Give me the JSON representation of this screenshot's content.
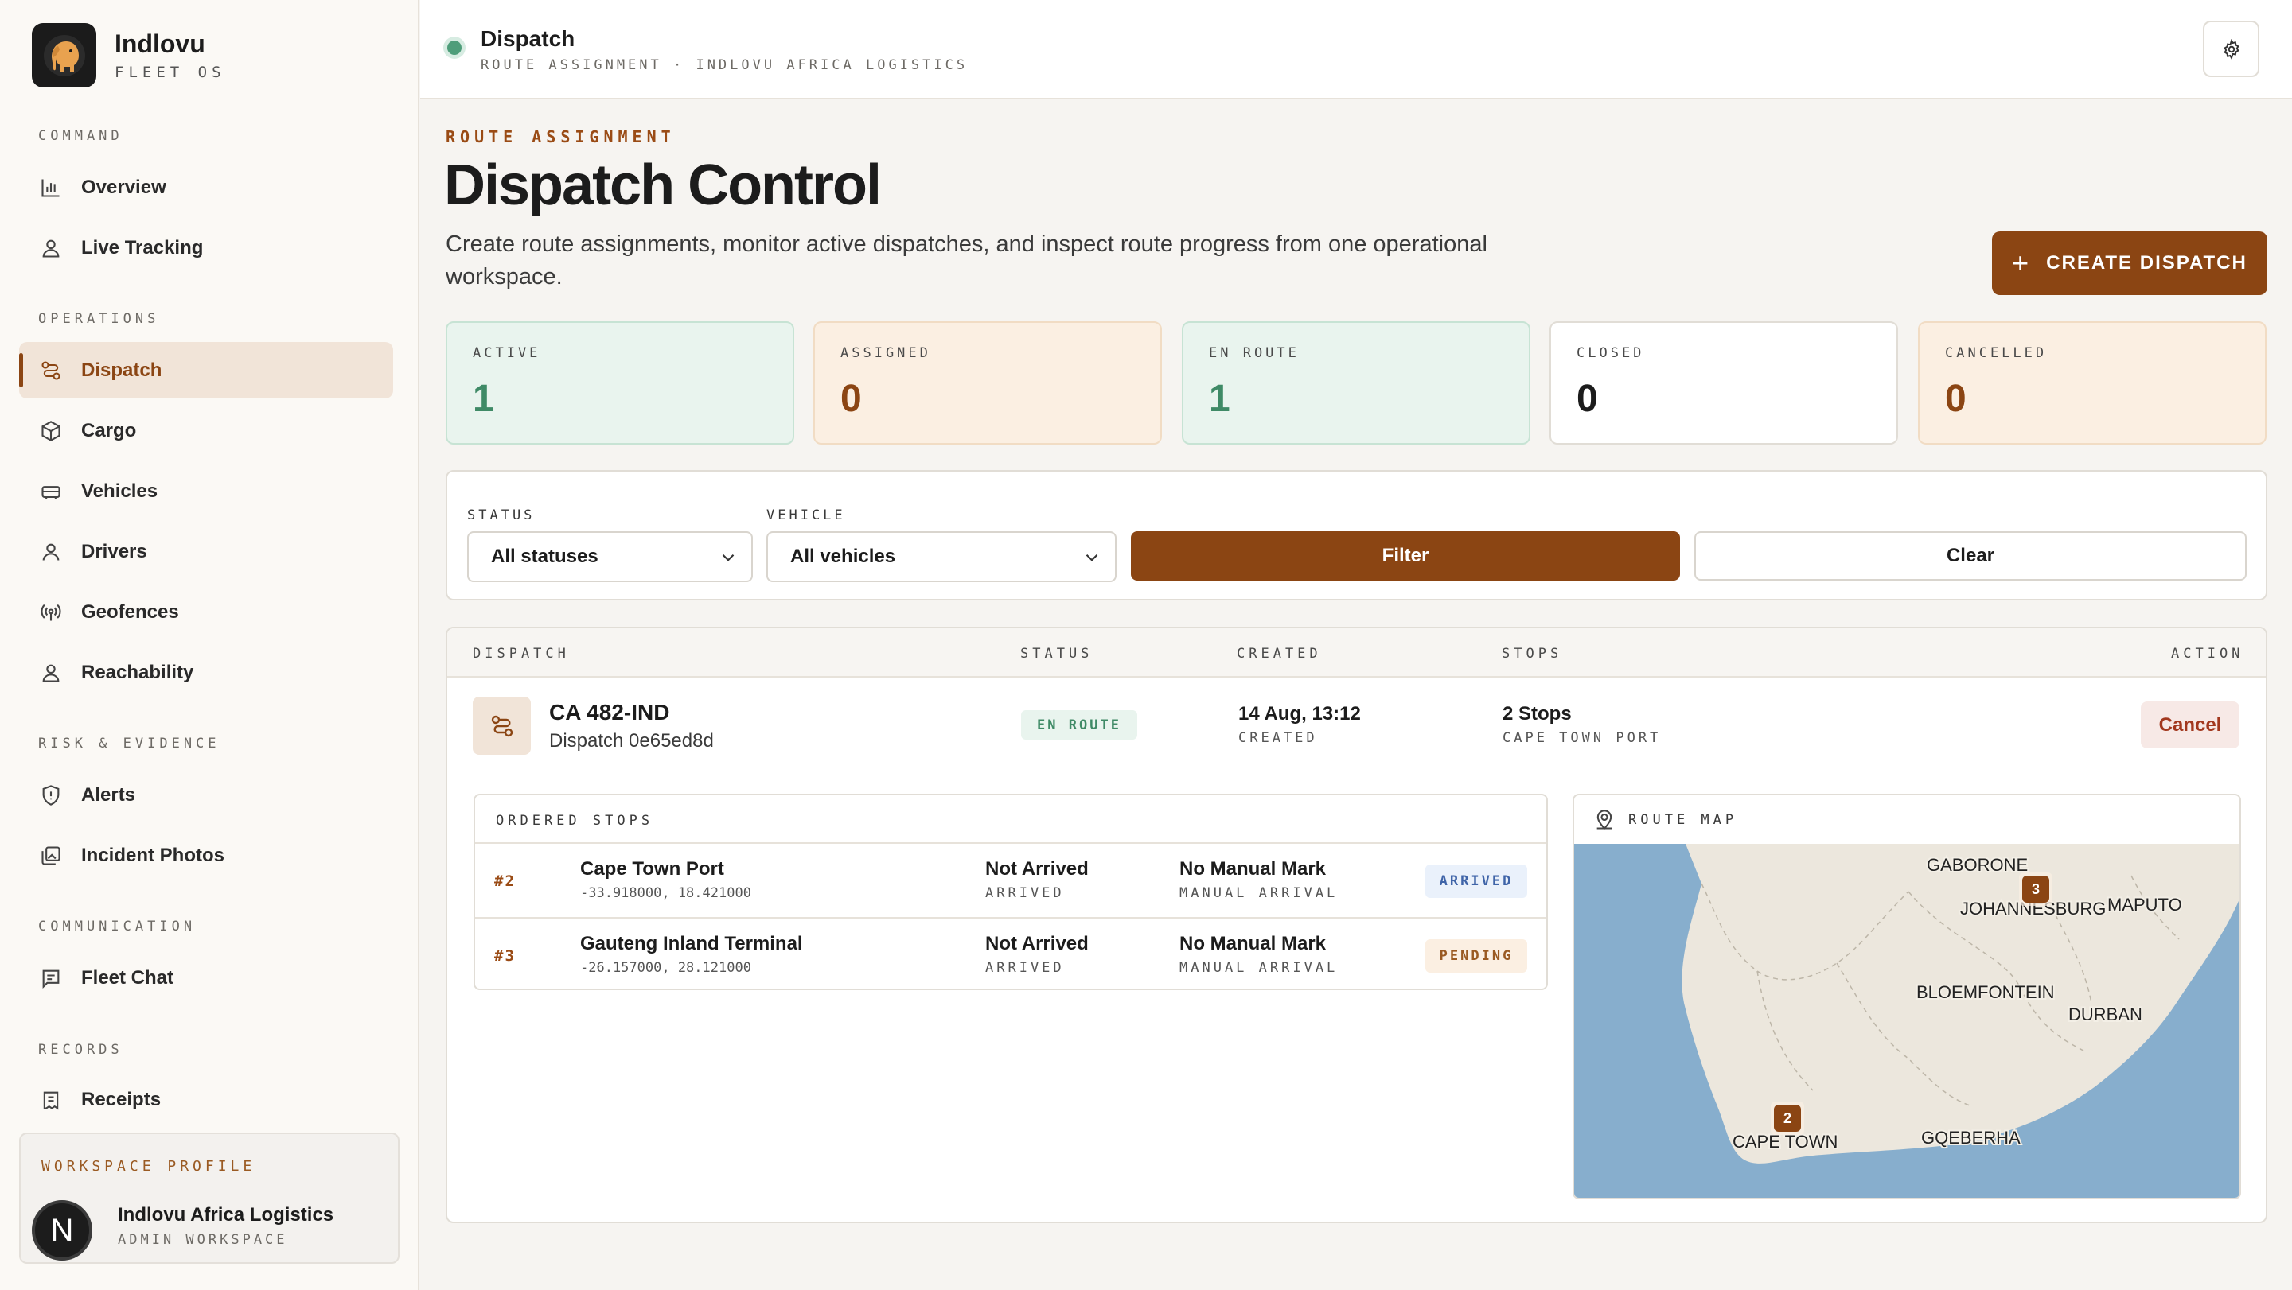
{
  "brand": {
    "name": "Indlovu",
    "sub": "FLEET OS"
  },
  "nav": {
    "sections": {
      "command": "COMMAND",
      "operations": "OPERATIONS",
      "risk": "RISK & EVIDENCE",
      "communication": "COMMUNICATION",
      "records": "RECORDS"
    },
    "items": {
      "overview": "Overview",
      "live_tracking": "Live Tracking",
      "dispatch": "Dispatch",
      "cargo": "Cargo",
      "vehicles": "Vehicles",
      "drivers": "Drivers",
      "geofences": "Geofences",
      "reachability": "Reachability",
      "alerts": "Alerts",
      "incident_photos": "Incident Photos",
      "fleet_chat": "Fleet Chat",
      "receipts": "Receipts"
    }
  },
  "profile": {
    "label": "WORKSPACE PROFILE",
    "avatar": "N",
    "name": "Indlovu Africa Logistics",
    "role": "ADMIN WORKSPACE"
  },
  "topbar": {
    "title": "Dispatch",
    "subtitle": "ROUTE ASSIGNMENT · INDLOVU AFRICA LOGISTICS"
  },
  "header": {
    "eyebrow": "ROUTE ASSIGNMENT",
    "title": "Dispatch Control",
    "description": "Create route assignments, monitor active dispatches, and inspect route progress from one operational workspace.",
    "create_label": "CREATE DISPATCH"
  },
  "stats": [
    {
      "label": "ACTIVE",
      "value": "1"
    },
    {
      "label": "ASSIGNED",
      "value": "0"
    },
    {
      "label": "EN ROUTE",
      "value": "1"
    },
    {
      "label": "CLOSED",
      "value": "0"
    },
    {
      "label": "CANCELLED",
      "value": "0"
    }
  ],
  "filters": {
    "status_label": "STATUS",
    "status_value": "All statuses",
    "vehicle_label": "VEHICLE",
    "vehicle_value": "All vehicles",
    "filter_label": "Filter",
    "clear_label": "Clear"
  },
  "table": {
    "columns": [
      "DISPATCH",
      "STATUS",
      "CREATED",
      "STOPS",
      "ACTION"
    ],
    "row": {
      "id": "CA 482-IND",
      "sub": "Dispatch 0e65ed8d",
      "status": "EN ROUTE",
      "created": "14 Aug, 13:12",
      "created_label": "CREATED",
      "stops": "2 Stops",
      "stops_sub": "CAPE TOWN PORT",
      "action": "Cancel"
    }
  },
  "stops": {
    "title": "ORDERED STOPS",
    "items": [
      {
        "num": "#2",
        "name": "Cape Town Port",
        "coord": "-33.918000, 18.421000",
        "arrival": "Not Arrived",
        "arrival_label": "ARRIVED",
        "manual": "No Manual Mark",
        "manual_label": "MANUAL ARRIVAL",
        "badge": "ARRIVED"
      },
      {
        "num": "#3",
        "name": "Gauteng Inland Terminal",
        "coord": "-26.157000, 28.121000",
        "arrival": "Not Arrived",
        "arrival_label": "ARRIVED",
        "manual": "No Manual Mark",
        "manual_label": "MANUAL ARRIVAL",
        "badge": "PENDING"
      }
    ]
  },
  "map": {
    "title": "ROUTE MAP",
    "cities": {
      "gaborone": "GABORONE",
      "johannesburg": "JOHANNESBURG",
      "maputo": "MAPUTO",
      "bloemfontein": "BLOEMFONTEIN",
      "durban": "DURBAN",
      "cape_town": "CAPE TOWN",
      "gqeberha": "GQEBERHA"
    },
    "markers": {
      "cape_town": "2",
      "johannesburg": "3"
    }
  },
  "colors": {
    "accent": "#8b4513",
    "active_bg": "#e9f4ee",
    "assigned_bg": "#fbefe2",
    "enroute_bg": "#e9f4ee",
    "closed_bg": "#ffffff",
    "cancelled_bg": "#fbefe2",
    "sea": "#87aecd",
    "land": "#ece7dd"
  }
}
